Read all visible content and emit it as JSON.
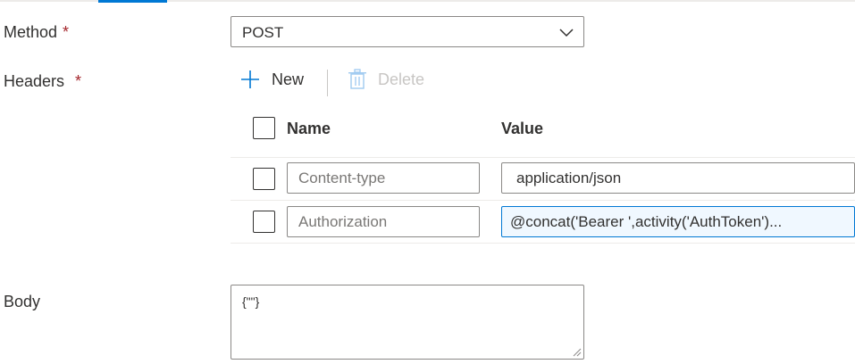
{
  "form": {
    "method": {
      "label": "Method",
      "required_mark": "*",
      "value": "POST"
    },
    "headers": {
      "label": "Headers",
      "required_mark": "*",
      "toolbar": {
        "new_label": "New",
        "delete_label": "Delete"
      },
      "columns": {
        "name": "Name",
        "value": "Value"
      },
      "rows": [
        {
          "name_placeholder": "Content-type",
          "value": "application/json"
        },
        {
          "name_placeholder": "Authorization",
          "value": "@concat('Bearer ',activity('AuthToken')..."
        }
      ]
    },
    "body": {
      "label": "Body",
      "value": "{\"\"}"
    }
  },
  "colors": {
    "accent": "#0078d4",
    "required": "#a4262c",
    "disabled": "#c8c6c4"
  },
  "icons": {
    "dropdown": "chevron-down-icon",
    "new": "plus-icon",
    "delete": "trash-icon"
  }
}
